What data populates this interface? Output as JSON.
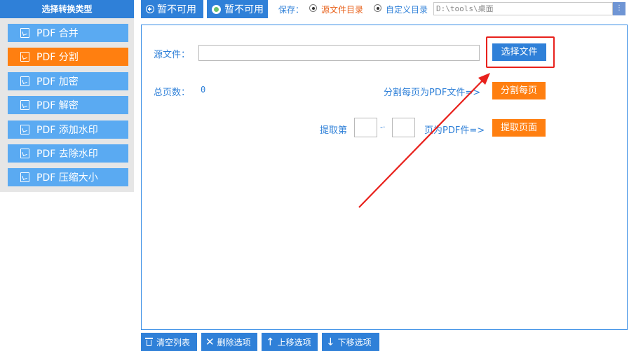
{
  "sidebar": {
    "title": "选择转换类型",
    "items": [
      {
        "label": "PDF 合并",
        "active": false
      },
      {
        "label": "PDF 分割",
        "active": true
      },
      {
        "label": "PDF 加密",
        "active": false
      },
      {
        "label": "PDF 解密",
        "active": false
      },
      {
        "label": "PDF 添加水印",
        "active": false
      },
      {
        "label": "PDF 去除水印",
        "active": false
      },
      {
        "label": "PDF 压缩大小",
        "active": false
      }
    ]
  },
  "toolbar": {
    "button1_label": "暂不可用",
    "button2_label": "暂不可用",
    "save_label": "保存：",
    "radio_source_label": "源文件目录",
    "radio_custom_label": "自定义目录",
    "path_value": "D:\\tools\\桌面",
    "browse_label": "⋮"
  },
  "main": {
    "source_label": "源文件：",
    "source_value": "",
    "select_file_label": "选择文件",
    "total_pages_label": "总页数：",
    "total_pages_value": "0",
    "split_desc": "分割每页为PDF文件=>",
    "split_button_label": "分割每页",
    "extract_prefix": "提取第",
    "extract_dash": "-·",
    "extract_suffix": "页为PDF件=>",
    "extract_button_label": "提取页面"
  },
  "bottom": {
    "clear_label": "清空列表",
    "delete_label": "删除选项",
    "up_label": "上移选项",
    "down_label": "下移选项"
  },
  "colors": {
    "primary": "#2f80d8",
    "sidebar_item": "#5aaaf2",
    "accent": "#ff7f10",
    "highlight": "#e8211c"
  }
}
